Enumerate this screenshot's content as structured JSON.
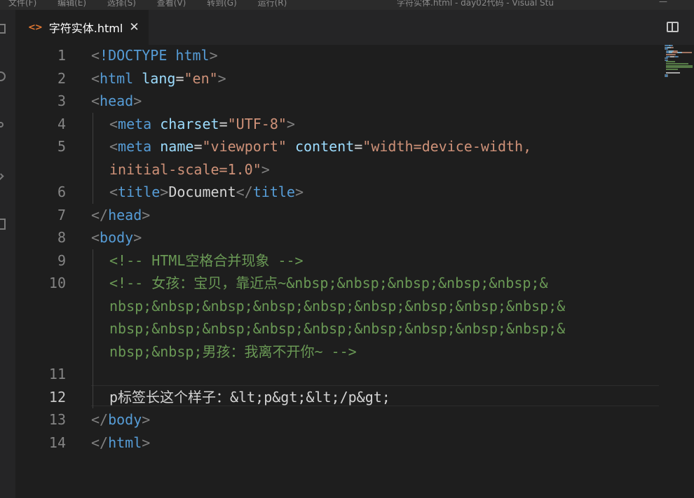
{
  "menubar": {
    "items": [
      "文件(F)",
      "编辑(E)",
      "选择(S)",
      "查看(V)",
      "转到(G)",
      "运行(R)"
    ],
    "window_title": "字符实体.html - day02代码 - Visual Stu"
  },
  "tab": {
    "icon": "html-file-icon",
    "icon_glyph": "<>",
    "label": "字符实体.html",
    "close_glyph": "✕"
  },
  "editor": {
    "active_line": 12,
    "lines": [
      {
        "num": "1",
        "indent": 0,
        "tokens": [
          [
            "punct",
            "<"
          ],
          [
            "tag",
            "!DOCTYPE"
          ],
          [
            "text",
            " "
          ],
          [
            "tag",
            "html"
          ],
          [
            "punct",
            ">"
          ]
        ]
      },
      {
        "num": "2",
        "indent": 0,
        "tokens": [
          [
            "punct",
            "<"
          ],
          [
            "tag",
            "html"
          ],
          [
            "text",
            " "
          ],
          [
            "attr",
            "lang"
          ],
          [
            "text",
            "="
          ],
          [
            "str",
            "\"en\""
          ],
          [
            "punct",
            ">"
          ]
        ]
      },
      {
        "num": "3",
        "indent": 0,
        "tokens": [
          [
            "punct",
            "<"
          ],
          [
            "tag",
            "head"
          ],
          [
            "punct",
            ">"
          ]
        ]
      },
      {
        "num": "4",
        "indent": 1,
        "tokens": [
          [
            "punct",
            "<"
          ],
          [
            "tag",
            "meta"
          ],
          [
            "text",
            " "
          ],
          [
            "attr",
            "charset"
          ],
          [
            "text",
            "="
          ],
          [
            "str",
            "\"UTF-8\""
          ],
          [
            "punct",
            ">"
          ]
        ]
      },
      {
        "num": "5",
        "indent": 1,
        "tokens": [
          [
            "punct",
            "<"
          ],
          [
            "tag",
            "meta"
          ],
          [
            "text",
            " "
          ],
          [
            "attr",
            "name"
          ],
          [
            "text",
            "="
          ],
          [
            "str",
            "\"viewport\""
          ],
          [
            "text",
            " "
          ],
          [
            "attr",
            "content"
          ],
          [
            "text",
            "="
          ],
          [
            "str",
            "\"width=device-width,"
          ]
        ]
      },
      {
        "num": "",
        "indent": 1,
        "tokens": [
          [
            "str",
            "initial-scale=1.0\""
          ],
          [
            "punct",
            ">"
          ]
        ]
      },
      {
        "num": "6",
        "indent": 1,
        "tokens": [
          [
            "punct",
            "<"
          ],
          [
            "tag",
            "title"
          ],
          [
            "punct",
            ">"
          ],
          [
            "text",
            "Document"
          ],
          [
            "punct",
            "</"
          ],
          [
            "tag",
            "title"
          ],
          [
            "punct",
            ">"
          ]
        ]
      },
      {
        "num": "7",
        "indent": 0,
        "tokens": [
          [
            "punct",
            "</"
          ],
          [
            "tag",
            "head"
          ],
          [
            "punct",
            ">"
          ]
        ]
      },
      {
        "num": "8",
        "indent": 0,
        "tokens": [
          [
            "punct",
            "<"
          ],
          [
            "tag",
            "body"
          ],
          [
            "punct",
            ">"
          ]
        ]
      },
      {
        "num": "9",
        "indent": 1,
        "tokens": [
          [
            "comment",
            "<!-- HTML空格合并现象 -->"
          ]
        ]
      },
      {
        "num": "10",
        "indent": 1,
        "tokens": [
          [
            "comment",
            "<!-- 女孩：宝贝，靠近点~&nbsp;&nbsp;&nbsp;&nbsp;&nbsp;&"
          ]
        ]
      },
      {
        "num": "",
        "indent": 1,
        "tokens": [
          [
            "comment",
            "nbsp;&nbsp;&nbsp;&nbsp;&nbsp;&nbsp;&nbsp;&nbsp;&nbsp;&"
          ]
        ]
      },
      {
        "num": "",
        "indent": 1,
        "tokens": [
          [
            "comment",
            "nbsp;&nbsp;&nbsp;&nbsp;&nbsp;&nbsp;&nbsp;&nbsp;&nbsp;&"
          ]
        ]
      },
      {
        "num": "",
        "indent": 1,
        "tokens": [
          [
            "comment",
            "nbsp;&nbsp;男孩：我离不开你~ -->"
          ]
        ]
      },
      {
        "num": "11",
        "indent": 1,
        "tokens": []
      },
      {
        "num": "12",
        "indent": 1,
        "tokens": [
          [
            "text",
            "p标签长这个样子：&lt;p&gt;&lt;/p&gt;"
          ]
        ]
      },
      {
        "num": "13",
        "indent": 0,
        "tokens": [
          [
            "punct",
            "</"
          ],
          [
            "tag",
            "body"
          ],
          [
            "punct",
            ">"
          ]
        ]
      },
      {
        "num": "14",
        "indent": 0,
        "tokens": [
          [
            "punct",
            "</"
          ],
          [
            "tag",
            "html"
          ],
          [
            "punct",
            ">"
          ]
        ]
      }
    ]
  },
  "colors": {
    "background": "#1e1e1e",
    "tag": "#569cd6",
    "attribute": "#9cdcfe",
    "string": "#ce9178",
    "comment": "#6a9955",
    "text": "#d4d4d4",
    "punctuation": "#808080",
    "line_number": "#858585",
    "html_icon": "#e37933"
  }
}
